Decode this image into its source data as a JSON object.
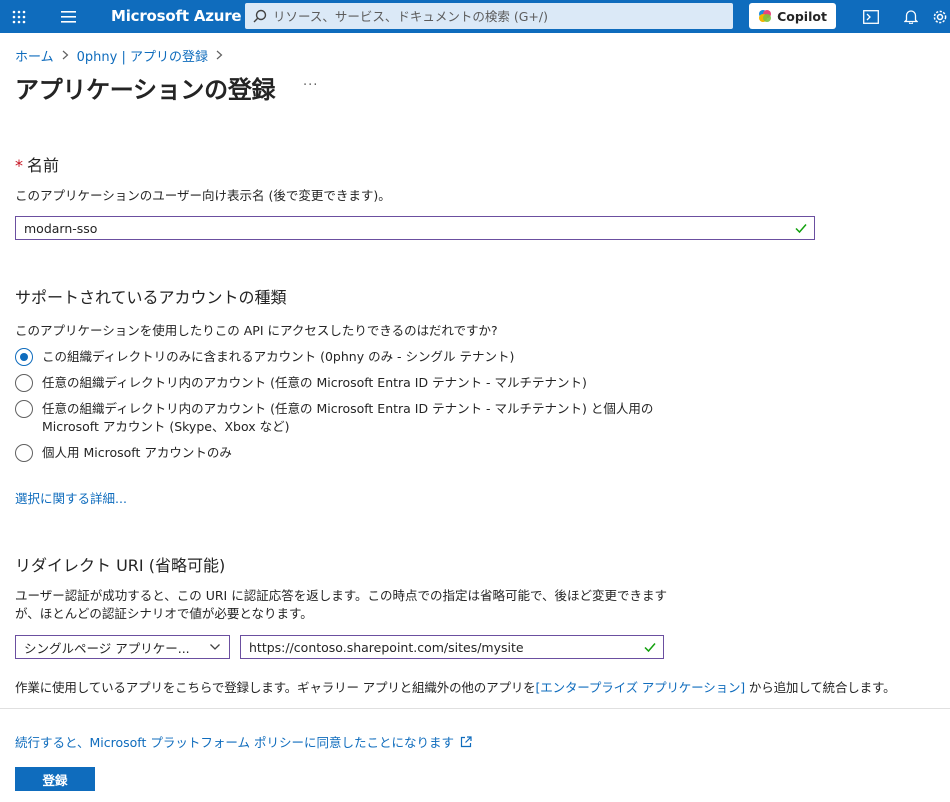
{
  "topbar": {
    "brand": "Microsoft Azure",
    "search_placeholder": "リソース、サービス、ドキュメントの検索 (G+/)",
    "copilot_label": "Copilot"
  },
  "breadcrumb": {
    "items": [
      "ホーム",
      "0phny | アプリの登録"
    ]
  },
  "page": {
    "title": "アプリケーションの登録",
    "more": "···"
  },
  "name_section": {
    "required_mark": "*",
    "heading": "名前",
    "description": "このアプリケーションのユーザー向け表示名 (後で変更できます)。",
    "value": "modarn-sso"
  },
  "account_section": {
    "heading": "サポートされているアカウントの種類",
    "question": "このアプリケーションを使用したりこの API にアクセスしたりできるのはだれですか?",
    "options": [
      {
        "label": "この組織ディレクトリのみに含まれるアカウント (0phny のみ - シングル テナント)",
        "checked": true
      },
      {
        "label": "任意の組織ディレクトリ内のアカウント (任意の Microsoft Entra ID テナント - マルチテナント)",
        "checked": false
      },
      {
        "label_line1": "任意の組織ディレクトリ内のアカウント (任意の Microsoft Entra ID テナント - マルチテナント) と個人用の",
        "label_line2": "Microsoft アカウント (Skype、Xbox など)",
        "checked": false
      },
      {
        "label": "個人用 Microsoft アカウントのみ",
        "checked": false
      }
    ],
    "details_link": "選択に関する詳細..."
  },
  "redirect_section": {
    "heading": "リダイレクト URI (省略可能)",
    "description_line1": "ユーザー認証が成功すると、この URI に認証応答を返します。この時点での指定は省略可能で、後ほど変更できます",
    "description_line2": "が、ほとんどの認証シナリオで値が必要となります。",
    "platform_selected": "シングルページ アプリケー...",
    "uri_value": "https://contoso.sharepoint.com/sites/mysite"
  },
  "gallery_note": {
    "prefix": "作業に使用しているアプリをこちらで登録します。ギャラリー アプリと組織外の他のアプリを",
    "link": "[エンタープライズ アプリケーション]",
    "suffix": " から追加して統合します。"
  },
  "footer": {
    "policy_link": "続行すると、Microsoft プラットフォーム ポリシーに同意したことになります",
    "register_label": "登録"
  },
  "colors": {
    "accent": "#0f6cbd",
    "required": "#c50f1f",
    "valid": "#13a10e",
    "focus": "#6b4fa0"
  }
}
